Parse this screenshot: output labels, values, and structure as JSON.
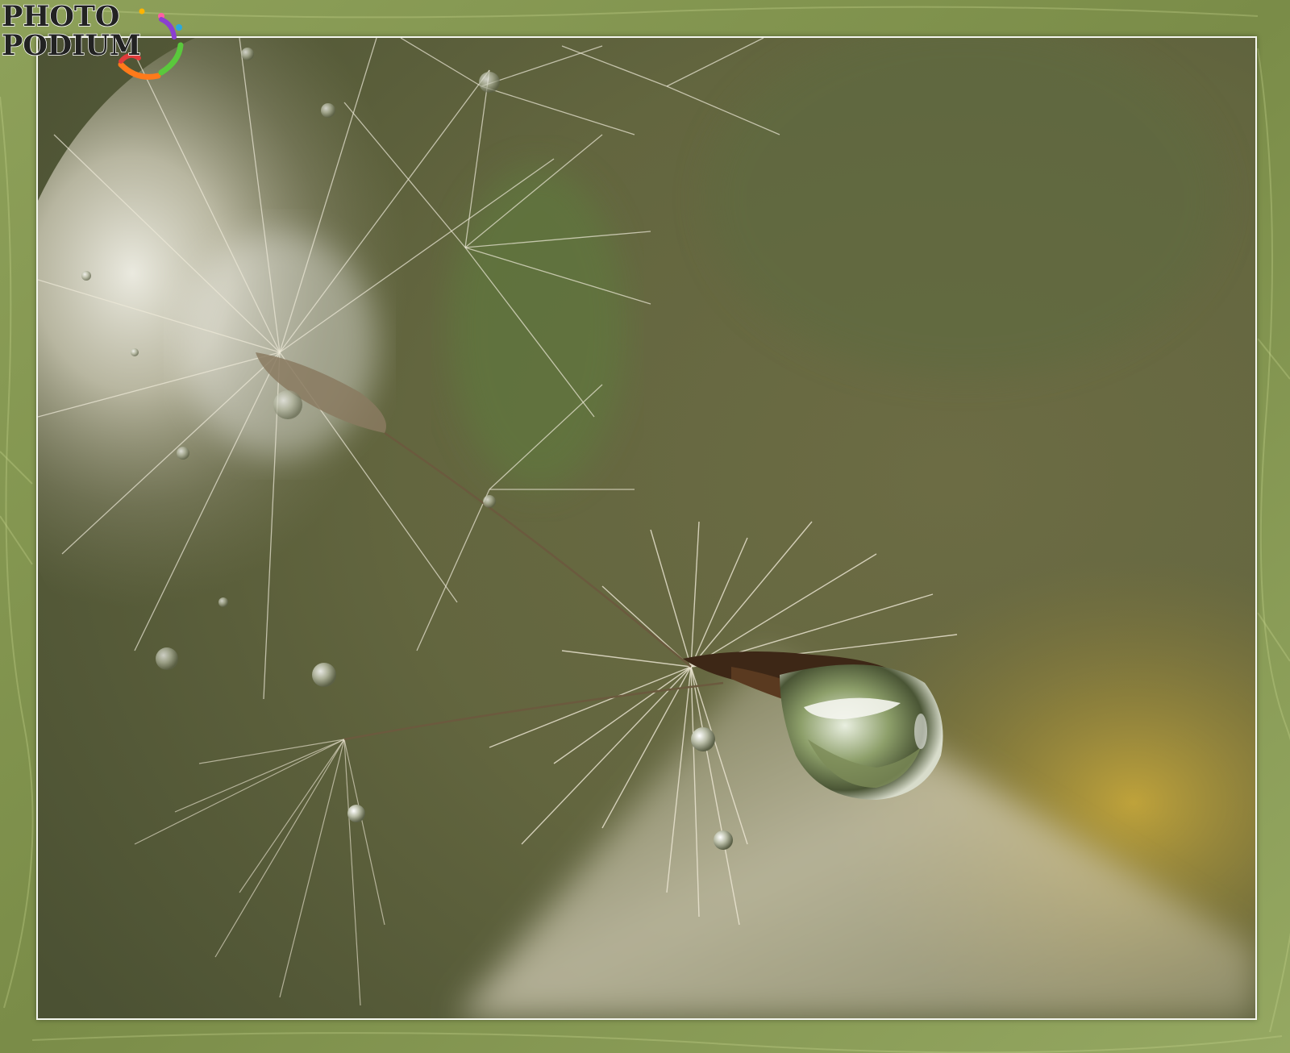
{
  "watermark": {
    "line1": "PHOTO",
    "line2": "PODIUM"
  },
  "scene": {
    "subject": "dandelion-seed-with-water-drop",
    "colors": {
      "frame_green": "#7d8f4e",
      "frame_light": "#b5c27a",
      "background_olive": "#6f7046",
      "background_dark": "#4e5433",
      "border_white": "#f4f6ee",
      "seed_brown": "#4a2f1a",
      "fluff_cream": "#e8e2d0",
      "highlight_yellow": "#c2a53a"
    }
  }
}
